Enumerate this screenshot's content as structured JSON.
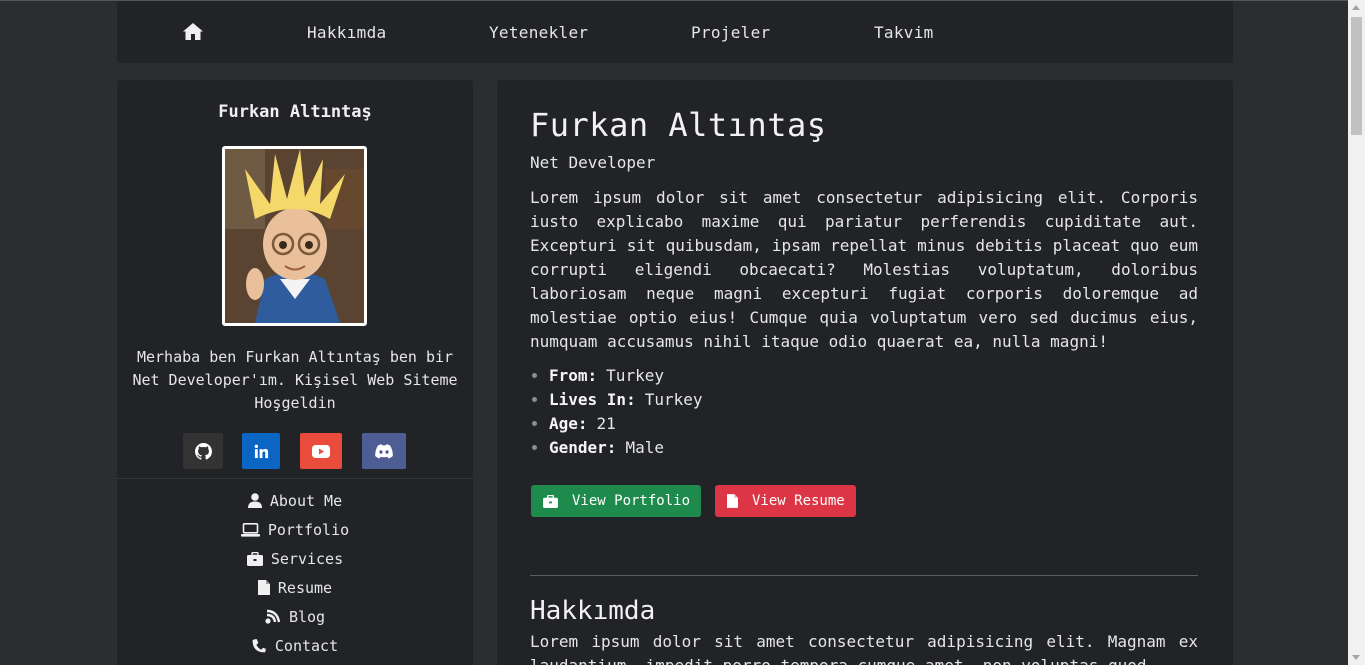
{
  "nav": {
    "home_icon": "home-icon",
    "items": [
      "Hakkımda",
      "Yetenekler",
      "Projeler",
      "Takvim"
    ]
  },
  "sidebar": {
    "name": "Furkan Altıntaş",
    "bio": "Merhaba ben Furkan Altıntaş ben bir Net Developer'ım. Kişisel Web Siteme Hoşgeldin",
    "socials": [
      {
        "icon": "github-icon",
        "color": "#333333"
      },
      {
        "icon": "linkedin-icon",
        "color": "#0a66c2"
      },
      {
        "icon": "youtube-icon",
        "color": "#e94b3c"
      },
      {
        "icon": "discord-icon",
        "color": "#5865f2"
      }
    ],
    "menu": [
      {
        "icon": "user-icon",
        "label": "About Me"
      },
      {
        "icon": "laptop-icon",
        "label": "Portfolio"
      },
      {
        "icon": "briefcase-icon",
        "label": "Services"
      },
      {
        "icon": "file-icon",
        "label": "Resume"
      },
      {
        "icon": "blog-icon",
        "label": "Blog"
      },
      {
        "icon": "phone-icon",
        "label": "Contact"
      }
    ]
  },
  "main": {
    "title": "Furkan Altıntaş",
    "subtitle": "Net Developer",
    "intro": "Lorem ipsum dolor sit amet consectetur adipisicing elit. Corporis iusto explicabo maxime qui pariatur perferendis cupiditate aut. Excepturi sit quibusdam, ipsam repellat minus debitis placeat quo eum corrupti eligendi obcaecati? Molestias voluptatum, doloribus laboriosam neque magni excepturi fugiat corporis doloremque ad molestiae optio eius! Cumque quia voluptatum vero sed ducimus eius, numquam accusamus nihil itaque odio quaerat ea, nulla magni!",
    "facts": [
      {
        "label": "From:",
        "value": "Turkey"
      },
      {
        "label": "Lives In:",
        "value": "Turkey"
      },
      {
        "label": "Age:",
        "value": "21"
      },
      {
        "label": "Gender:",
        "value": "Male"
      }
    ],
    "buttons": {
      "portfolio": "View Portfolio",
      "resume": "View Resume"
    },
    "about_title": "Hakkımda",
    "about_text": "Lorem ipsum dolor sit amet consectetur adipisicing elit. Magnam ex laudantium, impedit porro tempora cumque amet, non voluptas quod"
  },
  "colors": {
    "background": "#2b2d31",
    "panel": "#212327",
    "success": "#1e8a4c",
    "danger": "#dc3545"
  }
}
